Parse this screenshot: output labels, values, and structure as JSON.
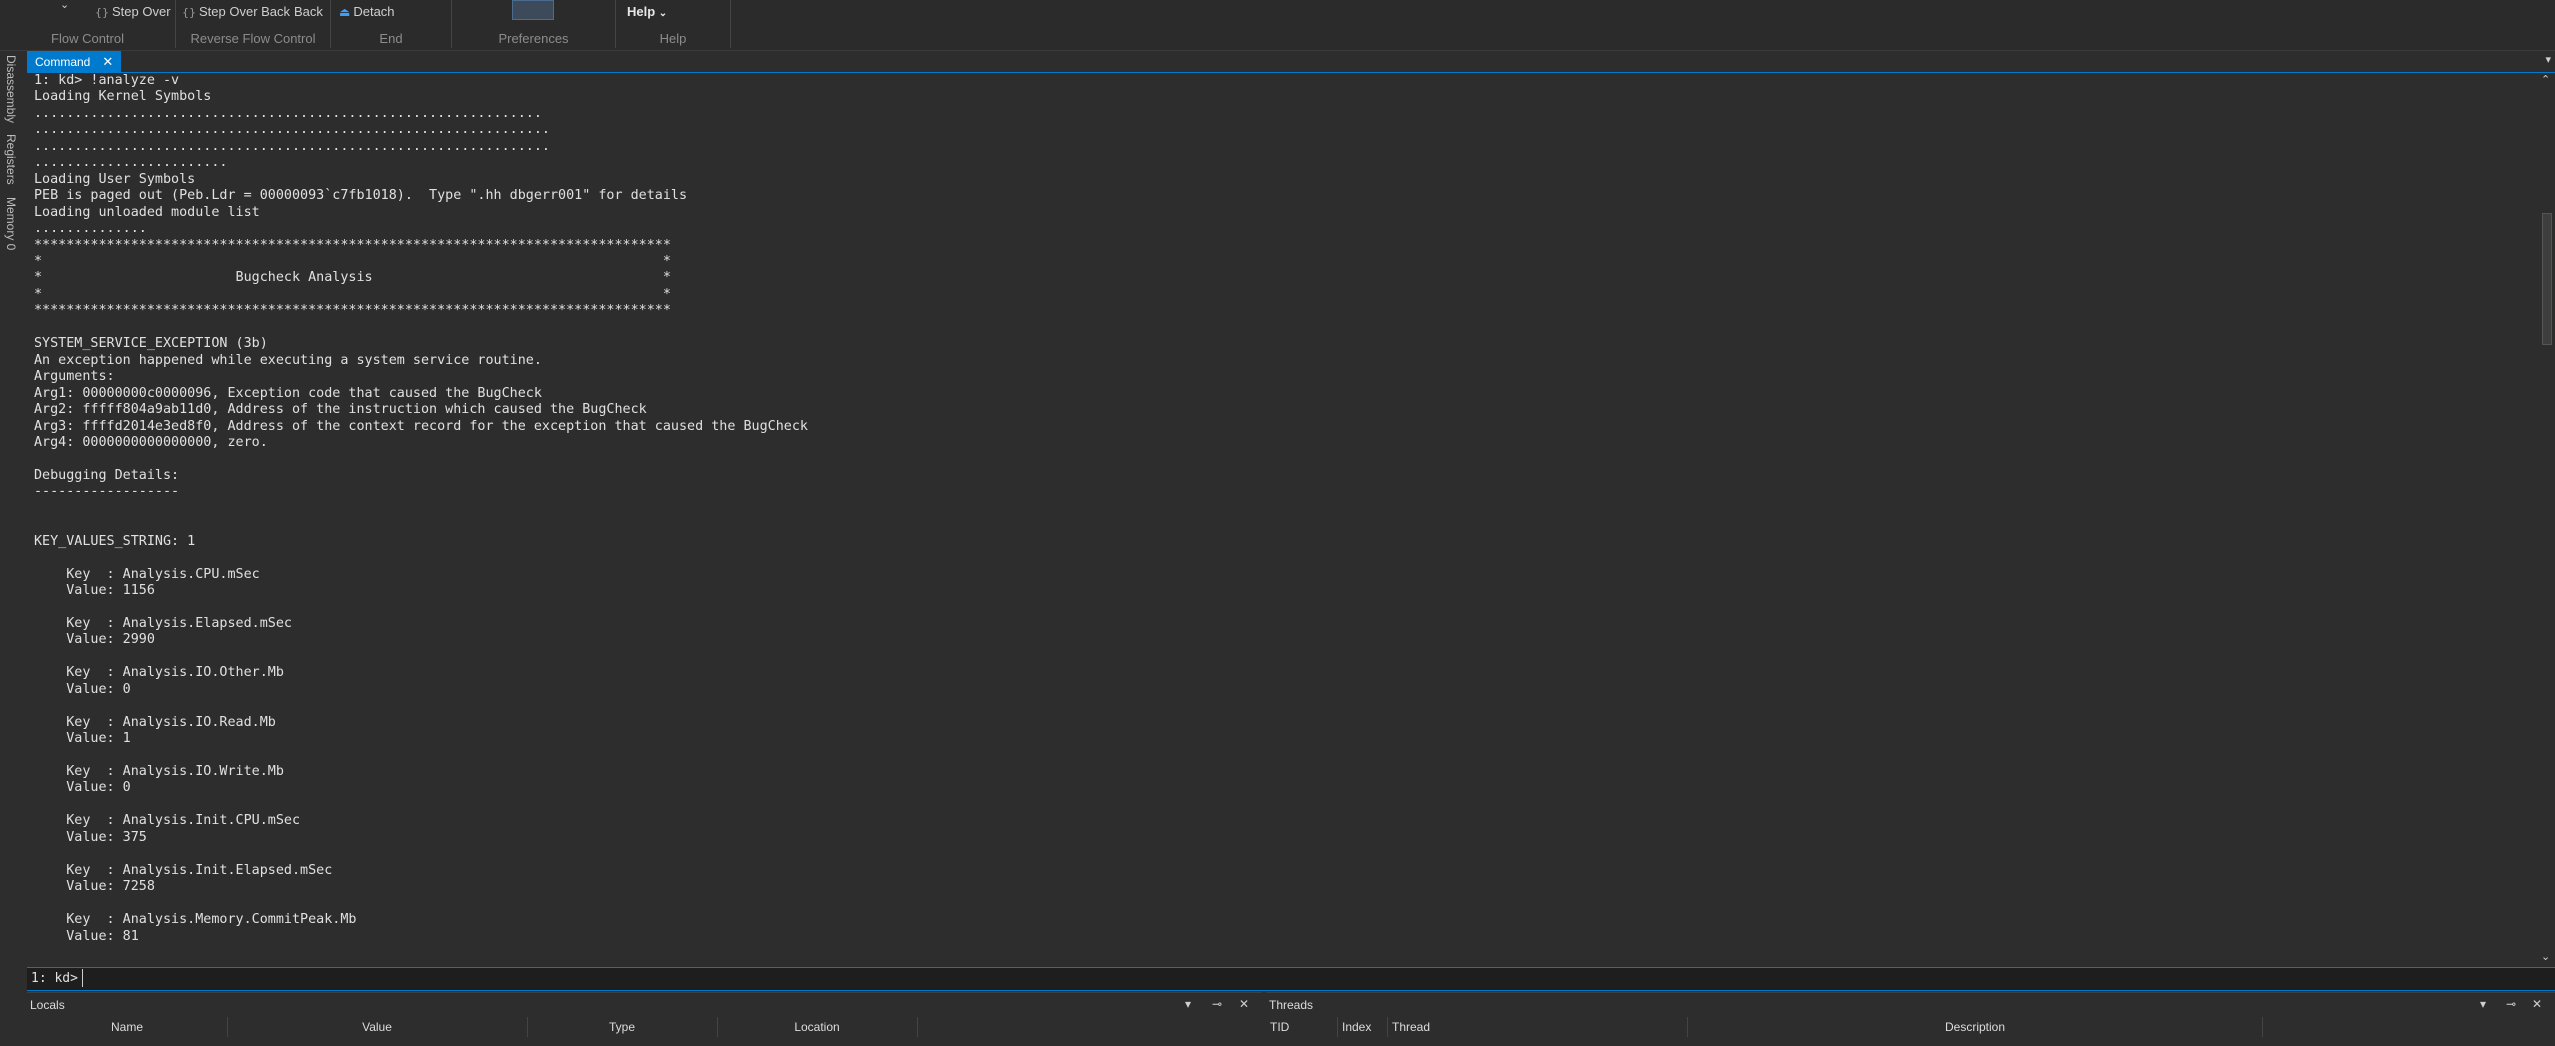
{
  "ribbon": {
    "groups": [
      {
        "label": "Flow Control"
      },
      {
        "label": "Reverse Flow Control"
      },
      {
        "label": "End"
      },
      {
        "label": "Preferences"
      },
      {
        "label": "Help"
      }
    ],
    "step_over_label": "Step Over",
    "step_over_back_label": "Step Over Back",
    "back_label": "Back",
    "detach_label": "Detach",
    "help_label": "Help"
  },
  "side_tabs": [
    "Disassembly",
    "Registers",
    "Memory 0"
  ],
  "command_window": {
    "tab_label": "Command",
    "output_lines": [
      "1: kd> !analyze -v",
      "Loading Kernel Symbols",
      "...............................................................",
      "................................................................",
      "................................................................",
      "........................",
      "Loading User Symbols",
      "PEB is paged out (Peb.Ldr = 00000093`c7fb1018).  Type \".hh dbgerr001\" for details",
      "Loading unloaded module list",
      "..............",
      "*******************************************************************************",
      "*                                                                             *",
      "*                        Bugcheck Analysis                                    *",
      "*                                                                             *",
      "*******************************************************************************",
      "",
      "SYSTEM_SERVICE_EXCEPTION (3b)",
      "An exception happened while executing a system service routine.",
      "Arguments:",
      "Arg1: 00000000c0000096, Exception code that caused the BugCheck",
      "Arg2: fffff804a9ab11d0, Address of the instruction which caused the BugCheck",
      "Arg3: ffffd2014e3ed8f0, Address of the context record for the exception that caused the BugCheck",
      "Arg4: 0000000000000000, zero.",
      "",
      "Debugging Details:",
      "------------------",
      "",
      "",
      "KEY_VALUES_STRING: 1",
      "",
      "    Key  : Analysis.CPU.mSec",
      "    Value: 1156",
      "",
      "    Key  : Analysis.Elapsed.mSec",
      "    Value: 2990",
      "",
      "    Key  : Analysis.IO.Other.Mb",
      "    Value: 0",
      "",
      "    Key  : Analysis.IO.Read.Mb",
      "    Value: 1",
      "",
      "    Key  : Analysis.IO.Write.Mb",
      "    Value: 0",
      "",
      "    Key  : Analysis.Init.CPU.mSec",
      "    Value: 375",
      "",
      "    Key  : Analysis.Init.Elapsed.mSec",
      "    Value: 7258",
      "",
      "    Key  : Analysis.Memory.CommitPeak.Mb",
      "    Value: 81"
    ],
    "prompt": "1: kd>",
    "input_value": ""
  },
  "locals_panel": {
    "title": "Locals",
    "columns": [
      "Name",
      "Value",
      "Type",
      "Location"
    ]
  },
  "threads_panel": {
    "title": "Threads",
    "columns": [
      "TID",
      "Index",
      "Thread",
      "Description"
    ]
  }
}
